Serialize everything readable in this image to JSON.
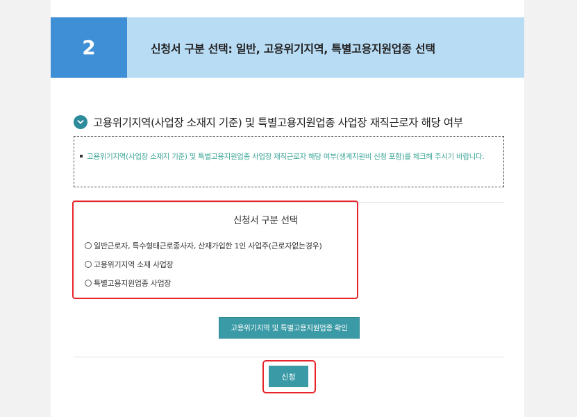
{
  "step": {
    "number": "2",
    "title": "신청서 구분 선택: 일반, 고용위기지역, 특별고용지원업종 선택"
  },
  "section": {
    "icon": "chevron-down-icon",
    "title": "고용위기지역(사업장 소재지 기준) 및 특별고용지원업종 사업장 재직근로자 해당 여부"
  },
  "notice": {
    "text": "고용위기지역(사업장 소재지 기준) 및 특별고용지원업종 사업장 재직근로자 해당 여부(생계지원비 신청 포함)를 체크해 주시기 바랍니다."
  },
  "selection": {
    "title": "신청서 구분 선택",
    "options": [
      {
        "label": "일반근로자, 특수형태근로종사자, 산재가입한 1인 사업주(근로자없는경우)"
      },
      {
        "label": "고용위기지역 소재 사업장"
      },
      {
        "label": "특별고용지원업종 사업장"
      }
    ]
  },
  "buttons": {
    "check_label": "고용위기지역 및 특별고용지원업종 확인",
    "submit_label": "신청"
  },
  "colors": {
    "step_number_bg": "#3f8fd6",
    "step_title_bg": "#b9dcf5",
    "accent_teal": "#3a9aa6",
    "notice_text": "#3aa596",
    "highlight_red": "#e8232a"
  }
}
